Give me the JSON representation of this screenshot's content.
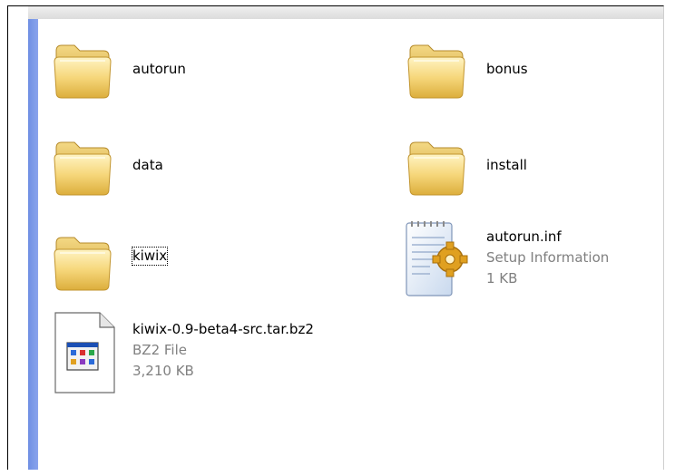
{
  "items": [
    {
      "label": "autorun"
    },
    {
      "label": "bonus"
    },
    {
      "label": "data"
    },
    {
      "label": "install"
    },
    {
      "label": "kiwix"
    },
    {
      "label": "autorun.inf",
      "type": "Setup Information",
      "size": "1 KB"
    },
    {
      "label": "kiwix-0.9-beta4-src.tar.bz2",
      "type": "BZ2 File",
      "size": "3,210 KB"
    }
  ],
  "icons": {
    "folder": "folder-icon",
    "inf": "setup-information-icon",
    "bz2": "archive-file-icon"
  },
  "colors": {
    "folder_top": "#fbe9a8",
    "folder_bottom": "#e3b94c",
    "sidebar": "#7b97e8"
  }
}
